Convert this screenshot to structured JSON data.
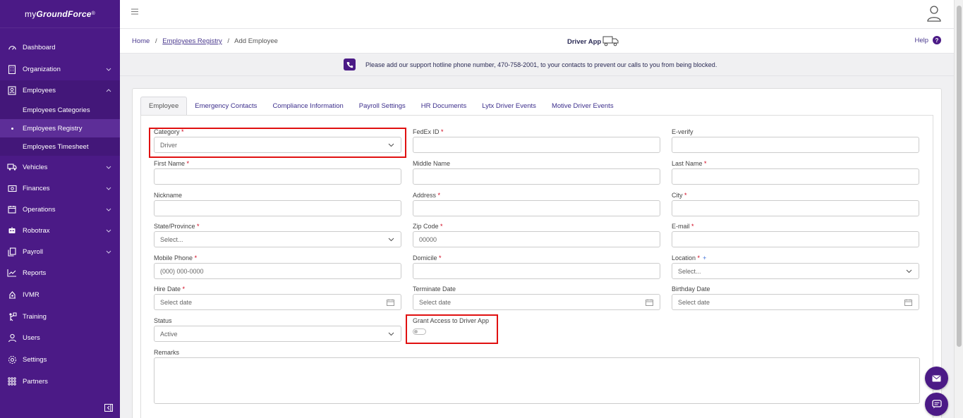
{
  "brand": {
    "part1": "my",
    "part2": "GroundForce",
    "mark": "®"
  },
  "sidebar": {
    "items": [
      {
        "label": "Dashboard",
        "icon": "gauge-icon"
      },
      {
        "label": "Organization",
        "icon": "building-icon"
      },
      {
        "label": "Employees",
        "icon": "id-card-icon"
      },
      {
        "label": "Vehicles",
        "icon": "truck-icon"
      },
      {
        "label": "Finances",
        "icon": "money-icon"
      },
      {
        "label": "Operations",
        "icon": "calendar-icon"
      },
      {
        "label": "Robotrax",
        "icon": "robot-icon"
      },
      {
        "label": "Payroll",
        "icon": "copy-icon"
      },
      {
        "label": "Reports",
        "icon": "chart-line-icon"
      },
      {
        "label": "IVMR",
        "icon": "ivmr-icon"
      },
      {
        "label": "Training",
        "icon": "training-icon"
      },
      {
        "label": "Users",
        "icon": "users-icon"
      },
      {
        "label": "Settings",
        "icon": "gear-icon"
      },
      {
        "label": "Partners",
        "icon": "grid-icon"
      }
    ],
    "employee_sub": [
      {
        "label": "Employees Categories"
      },
      {
        "label": "Employees Registry"
      },
      {
        "label": "Employees Timesheet"
      }
    ]
  },
  "breadcrumb": {
    "home": "Home",
    "sep": "/",
    "registry": "Employees Registry",
    "current": "Add Employee"
  },
  "header": {
    "driver_app": "Driver App",
    "help": "Help",
    "help_mark": "?"
  },
  "notice": "Please add our support hotline phone number, 470-758-2001, to your contacts to prevent our calls to you from being blocked.",
  "tabs": [
    "Employee",
    "Emergency Contacts",
    "Compliance Information",
    "Payroll Settings",
    "HR Documents",
    "Lytx Driver Events",
    "Motive Driver Events"
  ],
  "form": {
    "category": {
      "label": "Category",
      "req": "*",
      "value": "Driver"
    },
    "fedex_id": {
      "label": "FedEx ID",
      "req": "*"
    },
    "e_verify": {
      "label": "E-verify"
    },
    "first_name": {
      "label": "First Name",
      "req": "*"
    },
    "middle_name": {
      "label": "Middle Name"
    },
    "last_name": {
      "label": "Last Name",
      "req": "*"
    },
    "nickname": {
      "label": "Nickname"
    },
    "address": {
      "label": "Address",
      "req": "*"
    },
    "city": {
      "label": "City",
      "req": "*"
    },
    "state": {
      "label": "State/Province",
      "req": "*",
      "placeholder": "Select..."
    },
    "zip": {
      "label": "Zip Code",
      "req": "*",
      "placeholder": "00000"
    },
    "email": {
      "label": "E-mail",
      "req": "*"
    },
    "mobile": {
      "label": "Mobile Phone",
      "req": "*",
      "placeholder": "(000) 000-0000"
    },
    "domicile": {
      "label": "Domicile",
      "req": "*"
    },
    "location": {
      "label": "Location",
      "req": "*",
      "plus": "+",
      "placeholder": "Select..."
    },
    "hire_date": {
      "label": "Hire Date",
      "req": "*",
      "placeholder": "Select date"
    },
    "terminate_date": {
      "label": "Terminate Date",
      "placeholder": "Select date"
    },
    "birthday": {
      "label": "Birthday Date",
      "placeholder": "Select date"
    },
    "status": {
      "label": "Status",
      "value": "Active"
    },
    "grant_access": {
      "label": "Grant Access to Driver App"
    },
    "remarks": {
      "label": "Remarks"
    }
  },
  "colors": {
    "sidebar": "#4b1a86",
    "accent": "#4b1a86",
    "highlight": "#e01010",
    "required": "#d0021b"
  }
}
